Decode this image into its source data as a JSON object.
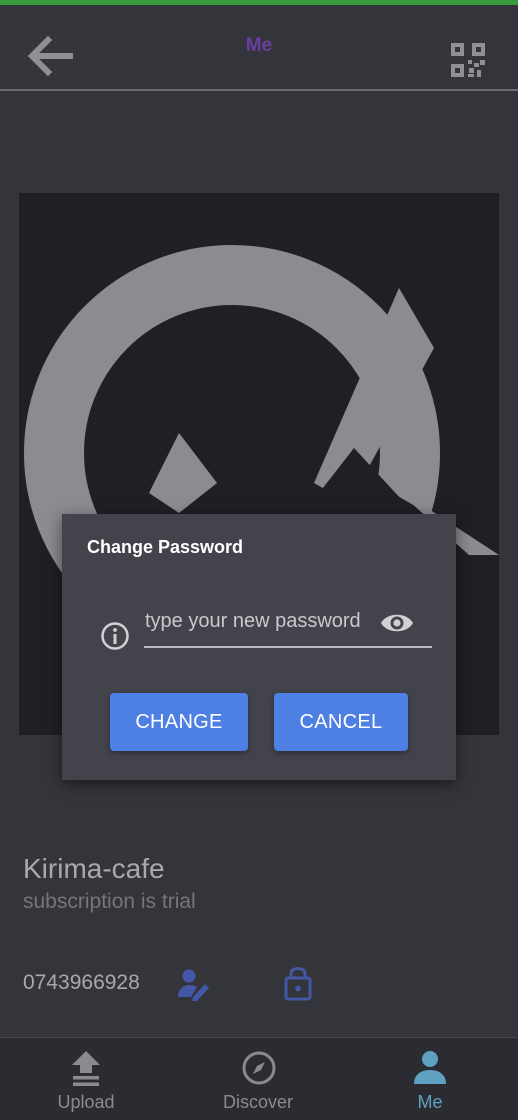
{
  "header": {
    "title": "Me",
    "back_icon": "arrow-back-icon",
    "qr_icon": "qr-code-icon",
    "title_color": "#6a3fa2"
  },
  "dialog": {
    "title": "Change Password",
    "input": {
      "value": "",
      "placeholder": "type your new password"
    },
    "info_icon": "info-icon",
    "visibility_icon": "eye-icon",
    "change_label": "CHANGE",
    "cancel_label": "CANCEL",
    "button_color": "#4e7fe3"
  },
  "profile": {
    "name": "Kirima-cafe",
    "subscription": "subscription is trial",
    "phone": "0743966928",
    "edit_icon": "edit-user-icon",
    "lock_icon": "lock-icon"
  },
  "bottom_nav": {
    "items": [
      {
        "label": "Upload",
        "icon": "upload-icon",
        "active": false
      },
      {
        "label": "Discover",
        "icon": "compass-icon",
        "active": false
      },
      {
        "label": "Me",
        "icon": "person-icon",
        "active": true
      }
    ],
    "active_color": "#5fa1c0"
  }
}
